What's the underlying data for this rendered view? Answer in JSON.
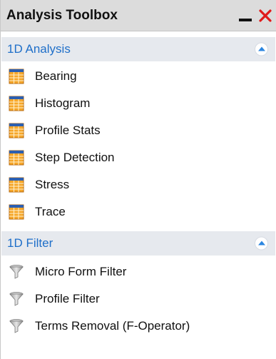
{
  "window": {
    "title": "Analysis Toolbox",
    "minimize_icon": "minimize-icon",
    "close_icon": "close-icon",
    "close_color": "#e01a1a"
  },
  "sections": [
    {
      "title": "1D Analysis",
      "title_color": "#1f6fc9",
      "collapse_icon": "chevron-up-icon",
      "item_icon": "spreadsheet-icon",
      "items": [
        {
          "label": "Bearing"
        },
        {
          "label": "Histogram"
        },
        {
          "label": "Profile Stats"
        },
        {
          "label": "Step Detection"
        },
        {
          "label": "Stress"
        },
        {
          "label": "Trace"
        }
      ]
    },
    {
      "title": "1D Filter",
      "title_color": "#1f6fc9",
      "collapse_icon": "chevron-up-icon",
      "item_icon": "filter-funnel-icon",
      "items": [
        {
          "label": "Micro Form Filter"
        },
        {
          "label": "Profile Filter"
        },
        {
          "label": "Terms Removal (F-Operator)"
        }
      ]
    }
  ]
}
